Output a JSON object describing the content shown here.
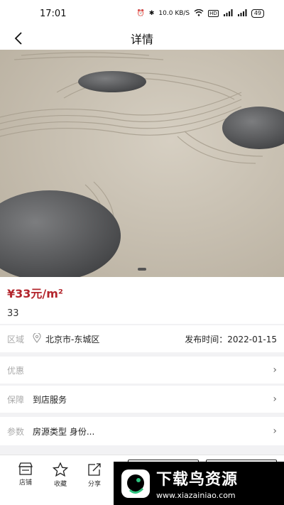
{
  "status_bar": {
    "time": "17:01",
    "network_speed": "10.0 KB/S",
    "hd_badge": "HD",
    "battery": "49"
  },
  "header": {
    "title": "详情"
  },
  "hero": {
    "carousel_total": 1,
    "carousel_active": 0
  },
  "price_card": {
    "price": "¥33元/m²",
    "subtitle": "33"
  },
  "area_row": {
    "label": "区域",
    "location": "北京市-东城区",
    "publish_label": "发布时间：",
    "publish_date": "2022-01-15"
  },
  "discount_row": {
    "label": "优惠"
  },
  "guarantee_row": {
    "label": "保障",
    "value": "到店服务"
  },
  "params_row": {
    "label": "参数",
    "value": "房源类型 身份..."
  },
  "bottom_bar": {
    "tabs": [
      {
        "label": "店铺"
      },
      {
        "label": "收藏"
      },
      {
        "label": "分享"
      }
    ]
  },
  "watermark": {
    "title": "下载鸟资源",
    "url": "www.xiazainiao.com"
  },
  "colors": {
    "accent": "#b3262d",
    "sand": "#cbc3b4",
    "stone": "#5e5f61"
  }
}
